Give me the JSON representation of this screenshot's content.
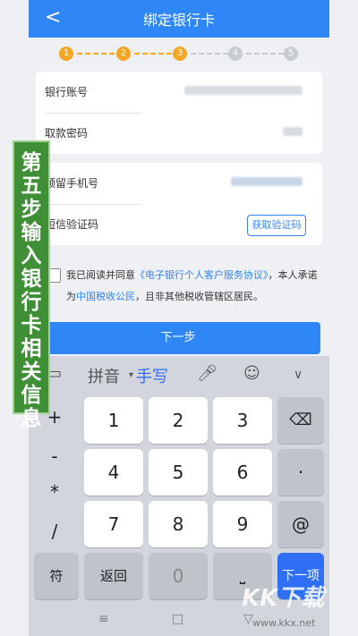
{
  "header": {
    "back": "<",
    "title": "绑定银行卡"
  },
  "steps": [
    "1",
    "2",
    "3",
    "4",
    "5"
  ],
  "steps_active": 3,
  "form": {
    "account_label": "银行账号",
    "pin_label": "取款密码",
    "phone_label": "预留手机号",
    "code_label": "短信验证码",
    "get_code_button": "获取验证码"
  },
  "agreement": {
    "prefix": "我已阅读并同意",
    "link1": "《电子银行个人客户服务协议》",
    "mid": "，本人承诺为",
    "link2": "中国税收公民",
    "suffix": "，且非其他税收管辖区居民。"
  },
  "next_button": "下一步",
  "keyboard": {
    "top": {
      "pinyin": "拼音",
      "handwrite": "手写"
    },
    "symbols": [
      "+",
      "-",
      "*",
      "/"
    ],
    "digits": [
      "1",
      "2",
      "3",
      "4",
      "5",
      "6",
      "7",
      "8",
      "9",
      "0"
    ],
    "dot": "·",
    "at": "@",
    "fu": "符",
    "back_label": "返回",
    "next_item": "下一项"
  },
  "banner_text": "第五步输入银行卡相关信息",
  "watermark": {
    "logo": "KK下载",
    "url": "www.kkx.net"
  }
}
